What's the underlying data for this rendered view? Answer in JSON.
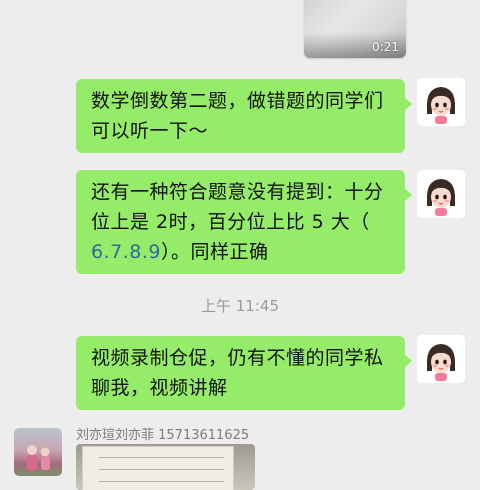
{
  "video_message": {
    "duration": "0:21"
  },
  "messages": [
    {
      "line1": "数学倒数第二题，做错题的同学们",
      "line2": "可以听一下～"
    },
    {
      "line1": "还有一种符合题意没有提到：十分",
      "line2": "位上是 2时，百分位上比 5 大（",
      "line3_num": "6.7.8.9",
      "line3_rest": "）。同样正确"
    },
    {
      "line1": "视频录制仓促，仍有不懂的同学私",
      "line2": "聊我，视频讲解"
    }
  ],
  "timestamp": "上午 11:45",
  "incoming": {
    "sender_name": "刘亦瑄刘亦菲 15713611625"
  },
  "colors": {
    "chat_bg": "#ededed",
    "bubble": "#95ec69",
    "number_link": "#2b6aa0"
  }
}
